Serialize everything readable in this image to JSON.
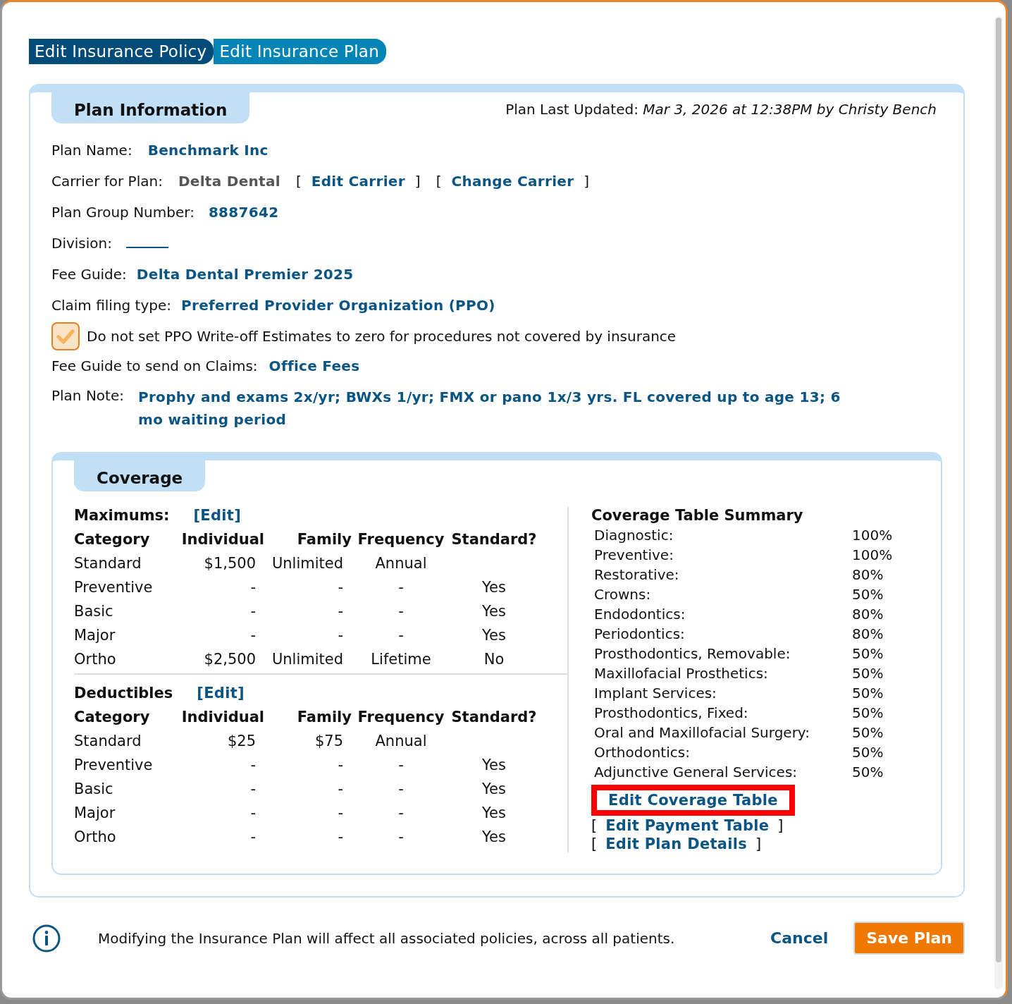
{
  "tabs": [
    {
      "label": "Edit Insurance Policy",
      "selected": false
    },
    {
      "label": "Edit Insurance Plan",
      "selected": true
    }
  ],
  "plan_information": {
    "title": "Plan Information",
    "last_updated_label": "Plan Last Updated:",
    "last_updated_value": "Mar 3, 2026 at 12:38PM by Christy Bench",
    "plan_name": {
      "label": "Plan Name:",
      "value": "Benchmark Inc"
    },
    "carrier": {
      "label": "Carrier for Plan:",
      "value": "Delta Dental",
      "links": [
        {
          "open": "[",
          "label": "Edit Carrier",
          "close": "]"
        },
        {
          "open": "[",
          "label": "Change Carrier",
          "close": "]"
        }
      ]
    },
    "group_number": {
      "label": "Plan Group Number:",
      "value": "8887642"
    },
    "division": {
      "label": "Division:"
    },
    "fee_guide": {
      "label": "Fee Guide:",
      "value": "Delta Dental Premier 2025"
    },
    "claim_filing_type": {
      "label": "Claim filing type:",
      "value": "Preferred Provider Organization (PPO)"
    },
    "ppo_option": {
      "label": "Do not set PPO Write-off Estimates to zero for procedures not covered by insurance",
      "checked": true
    },
    "claims_fee_guide": {
      "label": "Fee Guide to send on Claims:",
      "value": "Office Fees"
    },
    "plan_note": {
      "label": "Plan Note:",
      "value": "Prophy and exams 2x/yr; BWXs 1/yr; FMX or pano 1x/3 yrs. FL covered up to age 13; 6 mo waiting period"
    }
  },
  "coverage": {
    "title": "Coverage",
    "tables": [
      {
        "title": "Maximums:",
        "edit_link": "[Edit]",
        "columns": [
          "Category",
          "Individual",
          "Family",
          "Frequency",
          "Standard?"
        ],
        "rows": [
          [
            "Standard",
            "$1,500",
            "Unlimited",
            "Annual",
            ""
          ],
          [
            "Preventive",
            "-",
            "-",
            "-",
            "Yes"
          ],
          [
            "Basic",
            "-",
            "-",
            "-",
            "Yes"
          ],
          [
            "Major",
            "-",
            "-",
            "-",
            "Yes"
          ],
          [
            "Ortho",
            "$2,500",
            "Unlimited",
            "Lifetime",
            "No"
          ]
        ]
      },
      {
        "title": "Deductibles",
        "edit_link": "[Edit]",
        "columns": [
          "Category",
          "Individual",
          "Family",
          "Frequency",
          "Standard?"
        ],
        "rows": [
          [
            "Standard",
            "$25",
            "$75",
            "Annual",
            ""
          ],
          [
            "Preventive",
            "-",
            "-",
            "-",
            "Yes"
          ],
          [
            "Basic",
            "-",
            "-",
            "-",
            "Yes"
          ],
          [
            "Major",
            "-",
            "-",
            "-",
            "Yes"
          ],
          [
            "Ortho",
            "-",
            "-",
            "-",
            "Yes"
          ]
        ]
      }
    ],
    "summary": {
      "title": "Coverage Table Summary",
      "rows": [
        {
          "label": "Diagnostic:",
          "value": "100%"
        },
        {
          "label": "Preventive:",
          "value": "100%"
        },
        {
          "label": "Restorative:",
          "value": "80%"
        },
        {
          "label": "Crowns:",
          "value": "50%"
        },
        {
          "label": "Endodontics:",
          "value": "80%"
        },
        {
          "label": "Periodontics:",
          "value": "80%"
        },
        {
          "label": "Prosthodontics, Removable:",
          "value": "50%"
        },
        {
          "label": "Maxillofacial Prosthetics:",
          "value": "50%"
        },
        {
          "label": "Implant Services:",
          "value": "50%"
        },
        {
          "label": "Prosthodontics, Fixed:",
          "value": "50%"
        },
        {
          "label": "Oral and Maxillofacial Surgery:",
          "value": "50%"
        },
        {
          "label": "Orthodontics:",
          "value": "50%"
        },
        {
          "label": "Adjunctive General Services:",
          "value": "50%"
        }
      ],
      "links": [
        {
          "label": "Edit Coverage Table",
          "highlighted": true
        },
        {
          "open": "[",
          "label": "Edit Payment Table",
          "close": "]",
          "highlighted": false
        },
        {
          "open": "[",
          "label": "Edit Plan Details",
          "close": "]",
          "highlighted": false
        }
      ]
    }
  },
  "footer": {
    "message": "Modifying the Insurance Plan will affect all associated policies, across all patients.",
    "cancel": "Cancel",
    "save": "Save Plan"
  }
}
